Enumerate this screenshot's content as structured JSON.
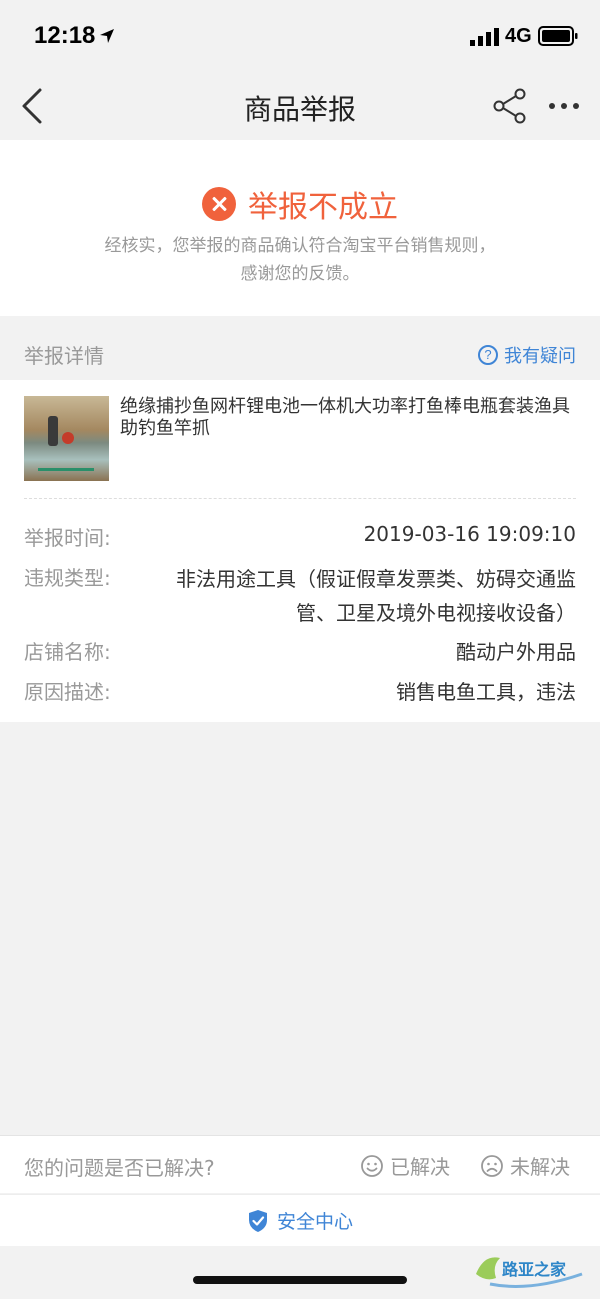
{
  "status_bar": {
    "time": "12:18",
    "network": "4G"
  },
  "nav": {
    "title": "商品举报"
  },
  "result": {
    "title": "举报不成立",
    "description_line1": "经核实，您举报的商品确认符合淘宝平台销售规则，",
    "description_line2": "感谢您的反馈。",
    "status_color": "#f0623c"
  },
  "section": {
    "title": "举报详情",
    "link_label": "我有疑问",
    "link_color": "#3f85d6"
  },
  "product": {
    "title": "绝缘捕抄鱼网杆锂电池一体机大功率打鱼棒电瓶套装渔具助钓鱼竿抓"
  },
  "details": [
    {
      "label": "举报时间:",
      "value": "2019-03-16 19:09:10"
    },
    {
      "label": "违规类型:",
      "value": "非法用途工具（假证假章发票类、妨碍交通监管、卫星及境外电视接收设备）"
    },
    {
      "label": "店铺名称:",
      "value": "酷动户外用品"
    },
    {
      "label": "原因描述:",
      "value": "销售电鱼工具，违法"
    }
  ],
  "feedback": {
    "question": "您的问题是否已解决?",
    "solved_label": "已解决",
    "unsolved_label": "未解决"
  },
  "security": {
    "label": "安全中心"
  },
  "watermark": {
    "text": "路亚之家"
  }
}
